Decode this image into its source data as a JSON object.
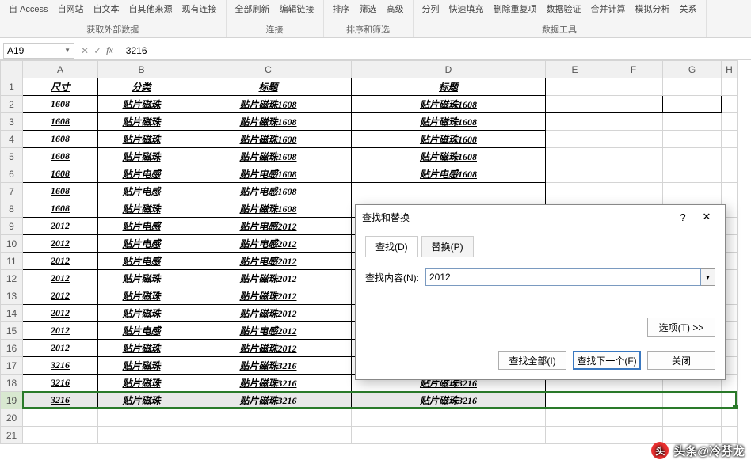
{
  "ribbon": {
    "groups": [
      {
        "label": "获取外部数据",
        "items": [
          "自 Access",
          "自网站",
          "自文本",
          "自其他来源",
          "现有连接"
        ]
      },
      {
        "label": "连接",
        "items": [
          "全部刷新",
          "编辑链接"
        ]
      },
      {
        "label": "排序和筛选",
        "items": [
          "排序",
          "筛选",
          "高级"
        ]
      },
      {
        "label": "数据工具",
        "items": [
          "分列",
          "快速填充",
          "删除重复项",
          "数据验证",
          "合并计算",
          "模拟分析",
          "关系"
        ]
      }
    ]
  },
  "namebox": "A19",
  "formula": "3216",
  "columns": [
    "A",
    "B",
    "C",
    "D",
    "E",
    "F",
    "G",
    "H"
  ],
  "header_row": [
    "尺寸",
    "分类",
    "标题",
    "标题"
  ],
  "rows": [
    [
      "1608",
      "贴片磁珠",
      "贴片磁珠1608",
      "贴片磁珠1608"
    ],
    [
      "1608",
      "贴片磁珠",
      "贴片磁珠1608",
      "贴片磁珠1608"
    ],
    [
      "1608",
      "贴片磁珠",
      "贴片磁珠1608",
      "贴片磁珠1608"
    ],
    [
      "1608",
      "贴片磁珠",
      "贴片磁珠1608",
      "贴片磁珠1608"
    ],
    [
      "1608",
      "贴片电感",
      "贴片电感1608",
      "贴片电感1608"
    ],
    [
      "1608",
      "贴片电感",
      "贴片电感1608",
      ""
    ],
    [
      "1608",
      "贴片磁珠",
      "贴片磁珠1608",
      ""
    ],
    [
      "2012",
      "贴片电感",
      "贴片电感2012",
      ""
    ],
    [
      "2012",
      "贴片电感",
      "贴片电感2012",
      ""
    ],
    [
      "2012",
      "贴片电感",
      "贴片电感2012",
      ""
    ],
    [
      "2012",
      "贴片磁珠",
      "贴片磁珠2012",
      ""
    ],
    [
      "2012",
      "贴片磁珠",
      "贴片磁珠2012",
      ""
    ],
    [
      "2012",
      "贴片磁珠",
      "贴片磁珠2012",
      ""
    ],
    [
      "2012",
      "贴片电感",
      "贴片电感2012",
      ""
    ],
    [
      "2012",
      "贴片磁珠",
      "贴片磁珠2012",
      ""
    ],
    [
      "3216",
      "贴片磁珠",
      "贴片磁珠3216",
      ""
    ],
    [
      "3216",
      "贴片磁珠",
      "贴片磁珠3216",
      "贴片磁珠3216"
    ],
    [
      "3216",
      "贴片磁珠",
      "贴片磁珠3216",
      "贴片磁珠3216"
    ]
  ],
  "selected_row": 19,
  "dialog": {
    "title": "查找和替换",
    "tab_find": "查找(D)",
    "tab_replace": "替换(P)",
    "find_label": "查找内容(N):",
    "find_value": "2012",
    "options_btn": "选项(T) >>",
    "find_all": "查找全部(I)",
    "find_next": "查找下一个(F)",
    "close": "关闭"
  },
  "watermark": "头条@冷芬龙"
}
